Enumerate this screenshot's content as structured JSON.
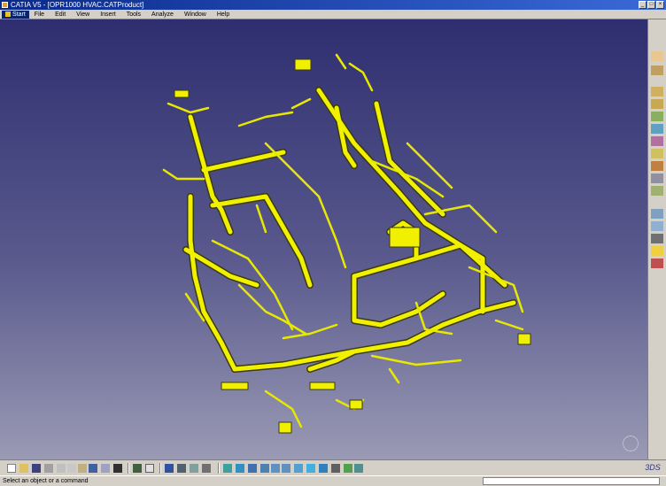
{
  "window": {
    "title": "CATIA V5 - [OPR1000 HVAC.CATProduct]"
  },
  "menu": {
    "start": "Start",
    "items": [
      "File",
      "Edit",
      "View",
      "Insert",
      "Tools",
      "Analyze",
      "Window",
      "Help"
    ]
  },
  "status": {
    "message": "Select an object or a command"
  },
  "colors": {
    "viewport_top": "#2e2e70",
    "viewport_bottom": "#9a9ab4",
    "duct": "#f0f000"
  }
}
